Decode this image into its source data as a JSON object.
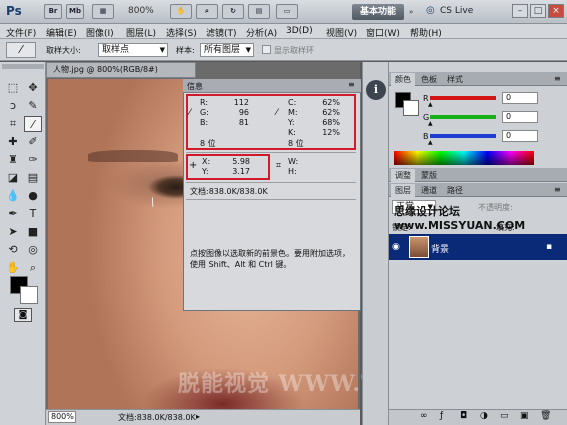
{
  "appbar": {
    "logo": "Ps",
    "br": "Br",
    "mb": "Mb",
    "zoom": "800%",
    "workspace": "基本功能",
    "cslive": "CS Live",
    "win": [
      "–",
      "□",
      "×"
    ]
  },
  "menus": [
    "文件(F)",
    "编辑(E)",
    "图像(I)",
    "图层(L)",
    "选择(S)",
    "滤镜(T)",
    "分析(A)",
    "3D(D)",
    "视图(V)",
    "窗口(W)",
    "帮助(H)"
  ],
  "options": {
    "sample_size_label": "取样大小:",
    "sample_size_value": "取样点",
    "sample_label": "样本:",
    "sample_value": "所有图层",
    "show_ring": "显示取样环"
  },
  "document": {
    "tab": "人物.jpg @ 800%(RGB/8#)",
    "zoom": "800%",
    "docsize": "文档:838.0K/838.0K",
    "watermark": "脱能视觉 WWW.TLVI.NET"
  },
  "info_panel": {
    "title": "信息",
    "rgb": [
      {
        "label": "R:",
        "value": "112"
      },
      {
        "label": "G:",
        "value": "96"
      },
      {
        "label": "B:",
        "value": "81"
      }
    ],
    "rgb_bits": "8 位",
    "cmyk": [
      {
        "label": "C:",
        "value": "62%"
      },
      {
        "label": "M:",
        "value": "62%"
      },
      {
        "label": "Y:",
        "value": "68%"
      },
      {
        "label": "K:",
        "value": "12%"
      }
    ],
    "cmyk_bits": "8 位",
    "xy": [
      {
        "label": "X:",
        "value": "5.98"
      },
      {
        "label": "Y:",
        "value": "3.17"
      }
    ],
    "wh": [
      {
        "label": "W:",
        "value": ""
      },
      {
        "label": "H:",
        "value": ""
      }
    ],
    "docsize": "文档:838.0K/838.0K",
    "hint": "点按图像以选取新的前景色。要用附加选项，使用 Shift、Alt 和 Ctrl 键。"
  },
  "color_panel": {
    "tabs": [
      "颜色",
      "色板",
      "样式"
    ],
    "channels": [
      {
        "label": "R",
        "value": "0",
        "color": "#d41414"
      },
      {
        "label": "G",
        "value": "0",
        "color": "#18b018"
      },
      {
        "label": "B",
        "value": "0",
        "color": "#1c3cd4"
      }
    ]
  },
  "adjust_tabs": [
    "调整",
    "蒙版"
  ],
  "layers_panel": {
    "tabs": [
      "图层",
      "通道",
      "路径"
    ],
    "blend": "正常",
    "opacity_label": "不透明度:",
    "fill_label": "填充:",
    "lock_label": "锁定:",
    "layer_name": "背景",
    "overlay": "思缘设计论坛 www.MISSYUAN.COM"
  }
}
